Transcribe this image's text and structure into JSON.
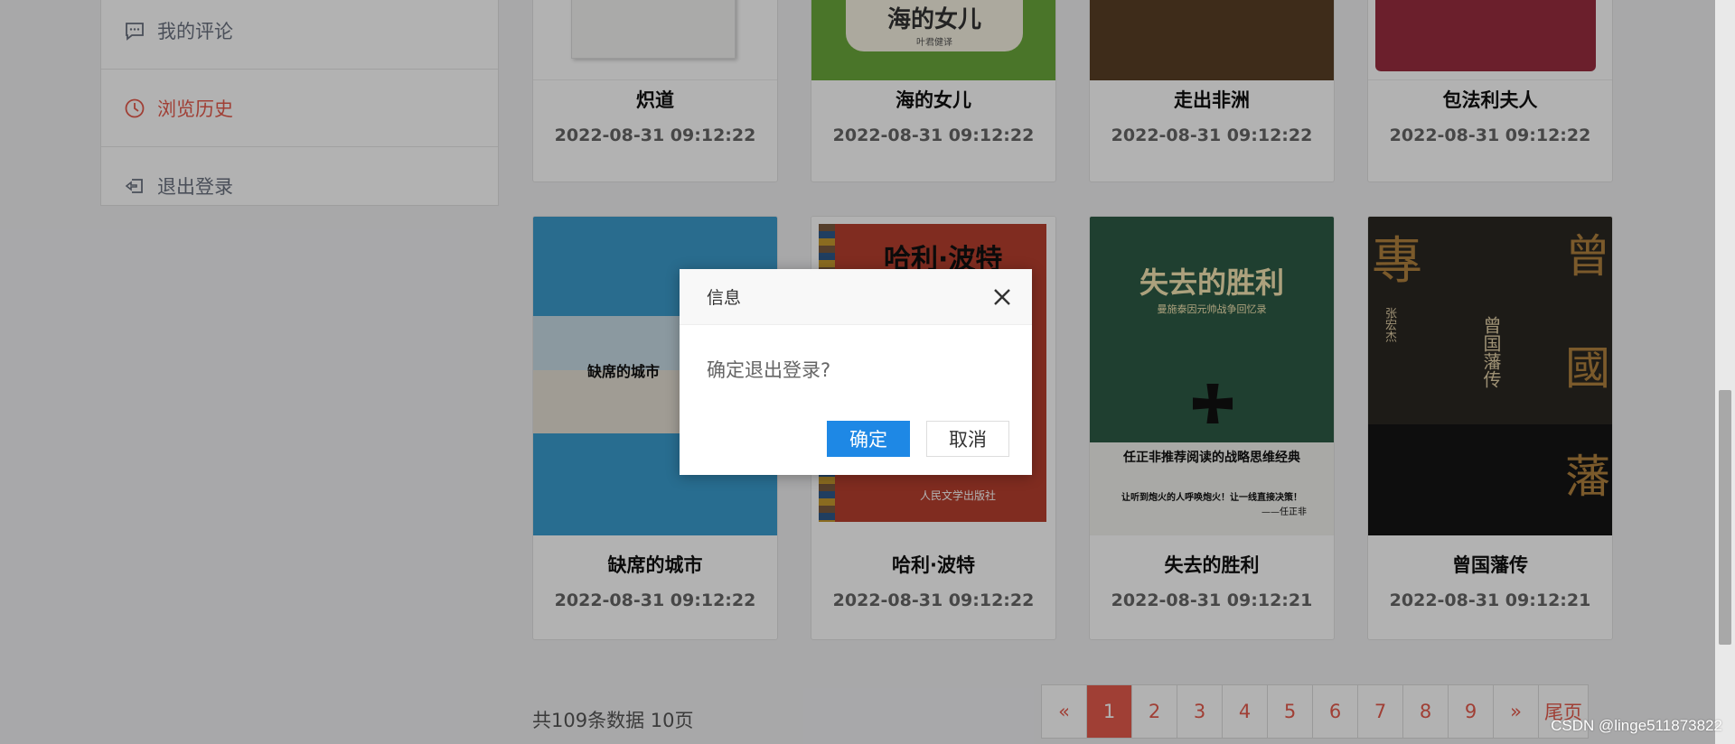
{
  "sidebar": {
    "items": [
      {
        "label": "我的评论",
        "icon": "comment-icon"
      },
      {
        "label": "浏览历史",
        "icon": "clock-icon",
        "active": true
      },
      {
        "label": "退出登录",
        "icon": "logout-icon"
      }
    ]
  },
  "books": [
    {
      "title": "炽道",
      "date": "2022-08-31 09:12:22"
    },
    {
      "title": "海的女儿",
      "date": "2022-08-31 09:12:22",
      "cover_text": "海的女儿",
      "cover_sub": "叶君健译"
    },
    {
      "title": "走出非洲",
      "date": "2022-08-31 09:12:22"
    },
    {
      "title": "包法利夫人",
      "date": "2022-08-31 09:12:22"
    },
    {
      "title": "缺席的城市",
      "date": "2022-08-31 09:12:22",
      "cover_text": "缺席的城市"
    },
    {
      "title": "哈利·波特",
      "date": "2022-08-31 09:12:22",
      "cover_text": "哈利·波特",
      "cover_sub": "人民文学出版社"
    },
    {
      "title": "失去的胜利",
      "date": "2022-08-31 09:12:21",
      "cover_text": "失去的胜利",
      "cover_sub": "曼施泰因元帅战争回忆录",
      "cover_line1": "任正非推荐阅读的战略思维经典",
      "cover_line2": "让听到炮火的人呼唤炮火！让一线直接决策！",
      "cover_line3": "——任正非"
    },
    {
      "title": "曾国藩传",
      "date": "2022-08-31 09:12:21",
      "cover_text": "曾国藩传",
      "cover_author": "张宏杰",
      "cover_big1": "專",
      "cover_big2": "曾",
      "cover_big3": "國",
      "cover_big4": "藩"
    }
  ],
  "pagination": {
    "summary": "共109条数据  10页",
    "prev": "«",
    "pages": [
      "1",
      "2",
      "3",
      "4",
      "5",
      "6",
      "7",
      "8",
      "9"
    ],
    "active_page": "1",
    "next": "»",
    "last": "尾页"
  },
  "dialog": {
    "title": "信息",
    "message": "确定退出登录?",
    "ok": "确定",
    "cancel": "取消"
  },
  "watermark": "CSDN @linge511873822",
  "colors": {
    "accent": "#e65b4d",
    "primary_button": "#1e88e5",
    "overlay": "rgba(0,0,0,0.3)"
  }
}
